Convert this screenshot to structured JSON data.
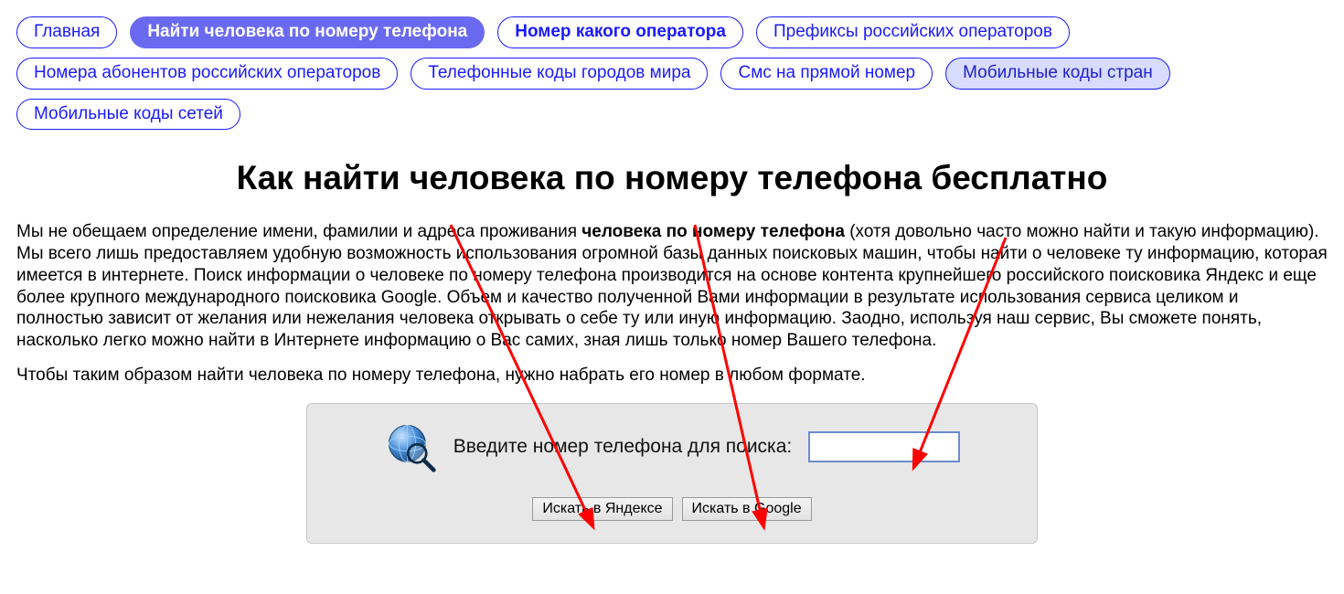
{
  "nav": {
    "row1": [
      {
        "label": "Главная",
        "style": "link"
      },
      {
        "label": "Найти человека по номеру телефона",
        "style": "active"
      },
      {
        "label": "Номер какого оператора",
        "style": "link-bold"
      },
      {
        "label": "Префиксы российских операторов",
        "style": "link"
      }
    ],
    "row2": [
      {
        "label": "Номера абонентов российских операторов",
        "style": "link"
      },
      {
        "label": "Телефонные коды городов мира",
        "style": "link"
      },
      {
        "label": "Смс на прямой номер",
        "style": "link"
      },
      {
        "label": "Мобильные коды стран",
        "style": "special"
      }
    ],
    "row3": [
      {
        "label": "Мобильные коды сетей",
        "style": "link"
      }
    ]
  },
  "title": "Как найти человека по номеру телефона бесплатно",
  "paragraph1_pre": "Мы не обещаем определение имени, фамилии и адреса проживания ",
  "paragraph1_bold": "человека по номеру телефона",
  "paragraph1_post": " (хотя довольно часто можно найти и такую информацию). Мы всего лишь предоставляем удобную возможность использования огромной базы данных поисковых машин, чтобы найти о человеке ту информацию, которая имеется в интернете. Поиск информации о человеке по номеру телефона производится на основе контента крупнейшего российского поисковика Яндекс и еще более крупного международного поисковика Google. Объем и качество полученной Вами информации в результате использования сервиса целиком и полностью зависит от желания или нежелания человека открывать о себе ту или иную информацию. Заодно, используя наш сервис, Вы сможете понять, насколько легко можно найти в Интернете информацию о Вас самих, зная лишь только номер Вашего телефона.",
  "paragraph2": "Чтобы таким образом найти человека по номеру телефона, нужно набрать его номер в любом формате.",
  "panel": {
    "label": "Введите номер телефона для поиска:",
    "input_value": "",
    "input_placeholder": "",
    "btn_yandex": "Искать в Яндексе",
    "btn_google": "Искать в Google"
  },
  "icons": {
    "globe": "globe-search-icon"
  },
  "annotation": {
    "arrows_color": "#ff0000"
  }
}
